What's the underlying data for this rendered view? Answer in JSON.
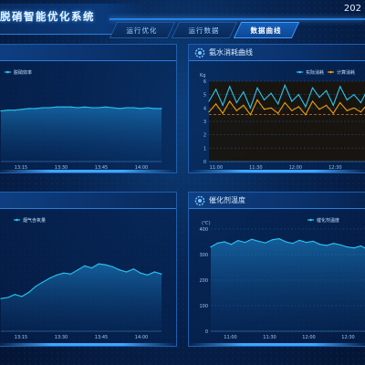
{
  "header": {
    "title": "脱硝智能优化系统",
    "year": "202",
    "tabs": [
      {
        "label": "运行优化",
        "active": false
      },
      {
        "label": "运行数据",
        "active": false
      },
      {
        "label": "数据曲线",
        "active": true
      }
    ]
  },
  "colors": {
    "accent": "#2a7fe0",
    "series_cyan": "#29c7f0",
    "series_orange": "#f5a000",
    "ref_line": "#f08a3a"
  },
  "panels": {
    "top_left": {
      "title": ""
    },
    "top_right": {
      "title": "氨水消耗曲线"
    },
    "bottom_left": {
      "title": ""
    },
    "bottom_right": {
      "title": "催化剂温度"
    }
  },
  "chart_data": [
    {
      "id": "top_left",
      "type": "line",
      "title": "",
      "legend": [
        "脱硝效率"
      ],
      "x": [
        "13:15",
        "13:30",
        "13:45",
        "14:00"
      ],
      "ylim": [
        0,
        100
      ],
      "series": [
        {
          "name": "脱硝效率",
          "values": [
            63,
            64,
            64,
            65,
            66,
            66,
            67,
            67,
            68,
            68,
            68,
            67,
            68,
            67,
            67,
            68,
            67,
            66,
            67,
            67,
            66,
            67,
            66,
            66
          ]
        }
      ]
    },
    {
      "id": "top_right",
      "type": "line",
      "title": "氨水消耗曲线",
      "unit": "Kg",
      "legend": [
        "实际消耗",
        "计算消耗"
      ],
      "x": [
        "11:00",
        "11:30",
        "12:00",
        "12:30"
      ],
      "yticks": [
        0,
        1,
        2,
        3,
        4,
        5,
        6
      ],
      "ylim": [
        0,
        6
      ],
      "reference": 3.5,
      "series": [
        {
          "name": "实际消耗",
          "values": [
            4.5,
            5.4,
            4.2,
            5.6,
            4.4,
            5.2,
            4.0,
            5.5,
            4.6,
            5.1,
            4.3,
            5.7,
            4.5,
            5.0,
            4.1,
            5.5,
            4.8,
            5.3,
            4.2,
            5.6,
            4.6,
            5.0,
            4.4,
            5.4
          ]
        },
        {
          "name": "计算消耗",
          "values": [
            3.7,
            4.3,
            3.6,
            4.5,
            3.8,
            4.2,
            3.5,
            4.6,
            3.9,
            4.0,
            3.6,
            4.4,
            3.8,
            4.1,
            3.5,
            4.5,
            3.9,
            4.2,
            3.6,
            4.4,
            3.8,
            4.0,
            3.7,
            4.3
          ]
        }
      ]
    },
    {
      "id": "bottom_left",
      "type": "line",
      "title": "",
      "legend": [
        "烟气含氧量"
      ],
      "x": [
        "13:15",
        "13:30",
        "13:45",
        "14:00"
      ],
      "ylim": [
        0,
        100
      ],
      "series": [
        {
          "name": "烟气含氧量",
          "values": [
            32,
            33,
            36,
            34,
            38,
            44,
            48,
            52,
            55,
            57,
            56,
            60,
            64,
            62,
            66,
            65,
            63,
            60,
            58,
            61,
            57,
            55,
            58,
            56
          ]
        }
      ]
    },
    {
      "id": "bottom_right",
      "type": "line",
      "title": "催化剂温度",
      "unit": "(℃)",
      "legend": [
        "催化剂温度"
      ],
      "x": [
        "11:00",
        "11:30",
        "12:00",
        "12:30"
      ],
      "yticks": [
        0,
        100,
        200,
        300,
        400
      ],
      "ylim": [
        0,
        400
      ],
      "series": [
        {
          "name": "催化剂温度",
          "values": [
            330,
            345,
            350,
            340,
            355,
            348,
            360,
            352,
            346,
            358,
            362,
            350,
            344,
            356,
            348,
            352,
            340,
            336,
            344,
            338,
            330,
            326,
            334,
            320
          ]
        }
      ]
    }
  ]
}
